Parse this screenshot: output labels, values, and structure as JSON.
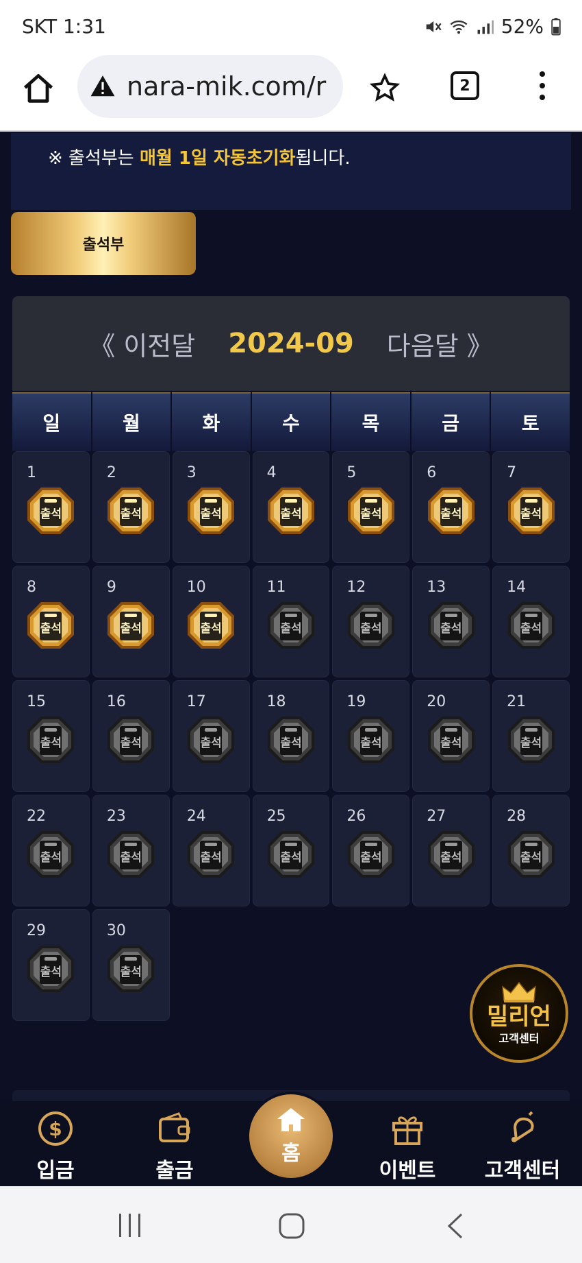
{
  "status_bar": {
    "carrier_time": "SKT 1:31",
    "battery": "52%"
  },
  "browser": {
    "url": "nara-mik.com/r",
    "tab_count": "2"
  },
  "notice": {
    "prefix": "※ 출석부는 ",
    "highlight": "매월 1일 자동초기화",
    "suffix": "됩니다."
  },
  "attendance_button": "출석부",
  "calendar": {
    "prev": "《 이전달",
    "month": "2024-09",
    "next": "다음달 》",
    "weekdays": [
      "일",
      "월",
      "화",
      "수",
      "목",
      "금",
      "토"
    ],
    "badge_label": "출석",
    "days": [
      "1",
      "2",
      "3",
      "4",
      "5",
      "6",
      "7",
      "8",
      "9",
      "10",
      "11",
      "12",
      "13",
      "14",
      "15",
      "16",
      "17",
      "18",
      "19",
      "20",
      "21",
      "22",
      "23",
      "24",
      "25",
      "26",
      "27",
      "28",
      "29",
      "30"
    ],
    "attended_through_day": 10
  },
  "float_logo": {
    "title": "밀리언",
    "subtitle": "고객센터"
  },
  "bottom_nav": {
    "deposit": "입금",
    "withdraw": "출금",
    "home": "홈",
    "event": "이벤트",
    "support": "고객센터"
  },
  "colors": {
    "accent_gold": "#f2c84b",
    "bg": "#0d1024",
    "cell": "#1c2036"
  }
}
